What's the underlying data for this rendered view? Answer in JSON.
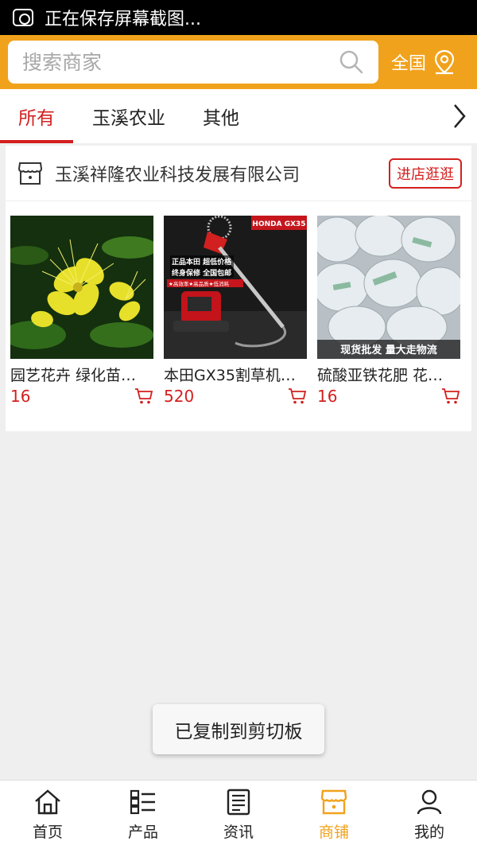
{
  "status_bar": {
    "text": "正在保存屏幕截图...",
    "icon": "screenshot-icon"
  },
  "search": {
    "placeholder": "搜索商家",
    "region_label": "全国"
  },
  "tabs": [
    {
      "label": "所有",
      "active": true
    },
    {
      "label": "玉溪农业",
      "active": false
    },
    {
      "label": "其他",
      "active": false
    }
  ],
  "shop": {
    "name": "玉溪祥隆农业科技发展有限公司",
    "visit_label": "进店逛逛",
    "products": [
      {
        "name": "园艺花卉 绿化苗…",
        "price": "16"
      },
      {
        "name": "本田GX35割草机…",
        "price": "520",
        "image_text": [
          "HONDA GX35",
          "正品本田 超低价格",
          "终身保修 全国包邮",
          "★高效率★高品质★低消耗"
        ]
      },
      {
        "name": "硫酸亚铁花肥 花…",
        "price": "16",
        "image_text": [
          "现货批发 量大走物流"
        ]
      }
    ]
  },
  "toast": {
    "text": "已复制到剪切板"
  },
  "bottom_nav": [
    {
      "label": "首页",
      "icon": "home-icon",
      "active": false
    },
    {
      "label": "产品",
      "icon": "product-list-icon",
      "active": false
    },
    {
      "label": "资讯",
      "icon": "news-icon",
      "active": false
    },
    {
      "label": "商铺",
      "icon": "shop-icon",
      "active": true
    },
    {
      "label": "我的",
      "icon": "user-icon",
      "active": false
    }
  ],
  "colors": {
    "accent": "#f1a21c",
    "red": "#d3201f",
    "background": "#efefef"
  }
}
